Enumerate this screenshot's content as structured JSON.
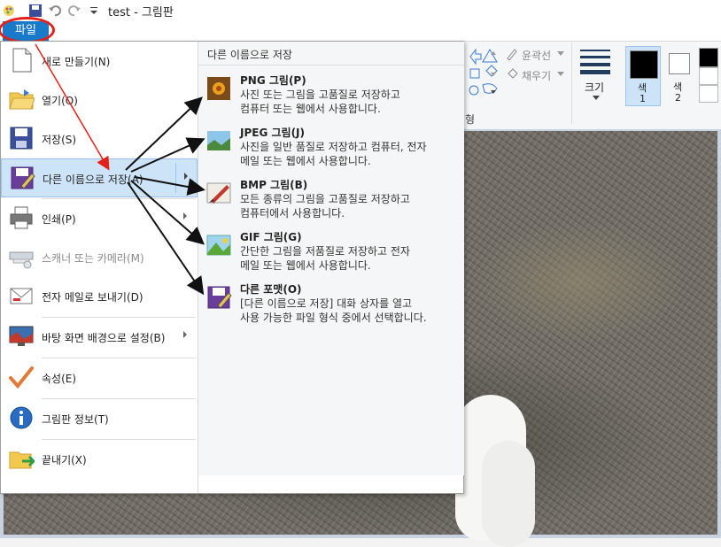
{
  "window": {
    "title": "test - 그림판"
  },
  "ribbon": {
    "file_tab": "파일",
    "outline_label": "윤곽선",
    "fill_label": "채우기",
    "size_label": "크기",
    "color1_label": "색",
    "color1_num": "1",
    "color2_label": "색",
    "color2_num": "2",
    "shapes_group_label": "형"
  },
  "menu": {
    "items": [
      {
        "label": "새로 만들기(N)",
        "icon": "new-file-icon"
      },
      {
        "label": "열기(O)",
        "icon": "open-folder-icon"
      },
      {
        "label": "저장(S)",
        "icon": "save-disk-icon"
      },
      {
        "label": "다른 이름으로 저장(A)",
        "icon": "save-as-icon"
      },
      {
        "label": "인쇄(P)",
        "icon": "printer-icon"
      },
      {
        "label": "스캐너 또는 카메라(M)",
        "icon": "scanner-icon"
      },
      {
        "label": "전자 메일로 보내기(D)",
        "icon": "email-icon"
      },
      {
        "label": "바탕 화면 배경으로 설정(B)",
        "icon": "desktop-icon"
      },
      {
        "label": "속성(E)",
        "icon": "checkmark-icon"
      },
      {
        "label": "그림판 정보(T)",
        "icon": "info-icon"
      },
      {
        "label": "끝내기(X)",
        "icon": "exit-icon"
      }
    ]
  },
  "submenu": {
    "title": "다른 이름으로 저장",
    "items": [
      {
        "heading": "PNG 그림(P)",
        "desc1": "사진 또는 그림을 고품질로 저장하고",
        "desc2": "컴퓨터 또는 웹에서 사용합니다.",
        "icon": "png-image-icon"
      },
      {
        "heading": "JPEG 그림(J)",
        "desc1": "사진을 일반 품질로 저장하고 컴퓨터, 전자",
        "desc2": "메일 또는 웹에서 사용합니다.",
        "icon": "jpeg-image-icon"
      },
      {
        "heading": "BMP 그림(B)",
        "desc1": "모든 종류의 그림을 고품질로 저장하고",
        "desc2": "컴퓨터에서 사용합니다.",
        "icon": "bmp-image-icon"
      },
      {
        "heading": "GIF 그림(G)",
        "desc1": "간단한 그림을 저품질로 저장하고 전자",
        "desc2": "메일 또는 웹에서 사용합니다.",
        "icon": "gif-image-icon"
      },
      {
        "heading": "다른 포맷(O)",
        "desc1": "[다른 이름으로 저장] 대화 상자를 열고",
        "desc2": "사용 가능한 파일 형식 중에서 선택합니다.",
        "icon": "other-format-icon"
      }
    ]
  },
  "colors": {
    "highlight": "#cde3f8",
    "file_tab": "#1979ca",
    "annotation_red": "#e32119"
  }
}
